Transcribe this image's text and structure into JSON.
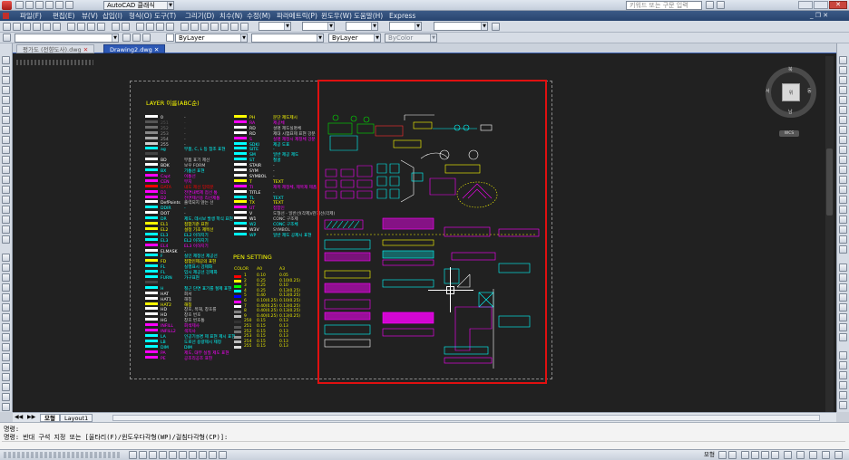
{
  "titlebar": {
    "workspace": "AutoCAD 클래식",
    "search_placeholder": "키워드 또는 구문 입력"
  },
  "menubar": {
    "items": [
      "파일(F)",
      "편집(E)",
      "뷰(V)",
      "삽입(I)",
      "형식(O)",
      "도구(T)",
      "그리기(D)",
      "치수(N)",
      "수정(M)",
      "파라메트릭(P)",
      "윈도우(W)",
      "도움말(H)",
      "Express"
    ]
  },
  "properties_bar": {
    "layer_combo": "ByLayer",
    "linetype_combo": "ByLayer",
    "color_combo": "ByColor"
  },
  "doc_tabs": [
    {
      "label": "평가도 (전향도사).dwg"
    },
    {
      "label": "Drawing2.dwg"
    }
  ],
  "viewcube": {
    "face": "위",
    "n": "북",
    "s": "남",
    "e": "동",
    "w": "서",
    "wcs": "WCS"
  },
  "drawing": {
    "layer_title": "LAYER 이름(ABC순)",
    "layers_left": [
      {
        "name": "0",
        "desc": "-",
        "color": "#ffffff"
      },
      {
        "name": "251",
        "desc": "-",
        "color": "#555555"
      },
      {
        "name": "252",
        "desc": "-",
        "color": "#6e6e6e"
      },
      {
        "name": "253",
        "desc": "-",
        "color": "#888888"
      },
      {
        "name": "254",
        "desc": "-",
        "color": "#a8a8a8"
      },
      {
        "name": "255",
        "desc": "-",
        "color": "#cccccc"
      },
      {
        "name": "ag",
        "desc": "부품, C, L 등 참조 표현",
        "color": "#00ffff"
      },
      {
        "name": "",
        "desc": "",
        "color": "#444444"
      },
      {
        "name": "BD",
        "desc": "부품 표기 제선",
        "color": "#ffffff"
      },
      {
        "name": "BDK",
        "desc": "보우 FORM",
        "color": "#ffffff"
      },
      {
        "name": "BX",
        "desc": "기통선 표현",
        "color": "#00ffff"
      },
      {
        "name": "Capt",
        "desc": "이통선",
        "color": "#ff00ff"
      },
      {
        "name": "CEN",
        "desc": "부지",
        "color": "#ff00ff"
      },
      {
        "name": "DATA",
        "desc": "내도 제선 입력분",
        "color": "#ff0000"
      },
      {
        "name": "D1",
        "desc": "전면내벽제 점선 통",
        "color": "#ff00ff"
      },
      {
        "name": "D2",
        "desc": "전면제선용 리선제통",
        "color": "#ff00ff"
      },
      {
        "name": "DefPoints",
        "desc": "출력되지 않는 선",
        "color": "#ffffff"
      },
      {
        "name": "DDIR",
        "desc": "-",
        "color": "#00ffff"
      },
      {
        "name": "DOT",
        "desc": "-",
        "color": "#ffffff"
      },
      {
        "name": "DR",
        "desc": "제도, 데시보 발생 학식 표현",
        "color": "#00ffff"
      },
      {
        "name": "EL1",
        "desc": "접합기준 표현",
        "color": "#ffff00"
      },
      {
        "name": "EL2",
        "desc": "설정 기초 제목선",
        "color": "#ffff00"
      },
      {
        "name": "EL3",
        "desc": "EL2 이하지기",
        "color": "#00ffff"
      },
      {
        "name": "EL3",
        "desc": "EL2 이하지기",
        "color": "#00ffff"
      },
      {
        "name": "EL4",
        "desc": "EL3 이하지기",
        "color": "#ff00ff"
      },
      {
        "name": "ELMASK",
        "desc": "-",
        "color": "#ffffff"
      },
      {
        "name": "F",
        "desc": "실인 제정선 제공선",
        "color": "#00ffff"
      },
      {
        "name": "FD",
        "desc": "접합인제공의 표현",
        "color": "#ffff00"
      },
      {
        "name": "FL",
        "desc": "실행표시 강제화",
        "color": "#00ffff"
      },
      {
        "name": "FL",
        "desc": "입시 제공선 강제화",
        "color": "#00ffff"
      },
      {
        "name": "FURN",
        "desc": "가구표현",
        "color": "#00ffff"
      },
      {
        "name": "",
        "desc": "",
        "color": "#444444"
      },
      {
        "name": "H",
        "desc": "철근 단면 표기를 절제 표현",
        "color": "#00ffff"
      },
      {
        "name": "HAT",
        "desc": "회서",
        "color": "#ffffff"
      },
      {
        "name": "HAT1",
        "desc": "해칭",
        "color": "#ffffff"
      },
      {
        "name": "HAT2",
        "desc": "해칭",
        "color": "#ffff00"
      },
      {
        "name": "HD",
        "desc": "창호, 목재, 창호를",
        "color": "#ffffff"
      },
      {
        "name": "HD",
        "desc": "창호 번호",
        "color": "#ffffff"
      },
      {
        "name": "HG",
        "desc": "창호 번호통",
        "color": "#ffffff"
      },
      {
        "name": "INFILL",
        "desc": "회색제사",
        "color": "#ff00ff"
      },
      {
        "name": "INFILL2",
        "desc": "색지사",
        "color": "#ff00ff"
      },
      {
        "name": "LA",
        "desc": "인공기설경 제 표현 제시 표현",
        "color": "#00ffff"
      },
      {
        "name": "LB",
        "desc": "도로선 용량제시 제정",
        "color": "#00ffff"
      },
      {
        "name": "DIM",
        "desc": "DIM",
        "color": "#00ffff"
      },
      {
        "name": "PA",
        "desc": "제도, 대부 실질 제도 표현",
        "color": "#ff00ff"
      },
      {
        "name": "PE",
        "desc": "공조리공조 표현",
        "color": "#ff00ff"
      }
    ],
    "layers_right": [
      {
        "name": "PH",
        "desc": "문단 제도제시",
        "color": "#ffff00"
      },
      {
        "name": "RA",
        "desc": "제공체",
        "color": "#ff00ff"
      },
      {
        "name": "RD",
        "desc": "설명 제도실명체",
        "color": "#ffffff"
      },
      {
        "name": "RD",
        "desc": "제대 시험표제 표현 강분",
        "color": "#ffffff"
      },
      {
        "name": "S",
        "desc": "실명 제정시 제정체 강분",
        "color": "#ff00ff"
      },
      {
        "name": "SDKI",
        "desc": "제공 도표",
        "color": "#00ffff"
      },
      {
        "name": "SITE",
        "desc": "-",
        "color": "#00ffff"
      },
      {
        "name": "SM",
        "desc": "일반 제공 제도",
        "color": "#00ffff"
      },
      {
        "name": "ST",
        "desc": "철골",
        "color": "#00ffff"
      },
      {
        "name": "STAIR",
        "desc": "-",
        "color": "#ffffff"
      },
      {
        "name": "SYM",
        "desc": "-",
        "color": "#ffffff"
      },
      {
        "name": "SYMBOL",
        "desc": "-",
        "color": "#ffffff"
      },
      {
        "name": "T",
        "desc": "TEXT",
        "color": "#ffff00"
      },
      {
        "name": "TI",
        "desc": "제목 제정체, 제목재 제품",
        "color": "#ff00ff"
      },
      {
        "name": "TITLE",
        "desc": "-",
        "color": "#ffffff"
      },
      {
        "name": "TL",
        "desc": "TEXT",
        "color": "#00ffff"
      },
      {
        "name": "TX",
        "desc": "TEXT",
        "color": "#ffff00"
      },
      {
        "name": "UT",
        "desc": "접합인",
        "color": "#ff00ff"
      },
      {
        "name": "V",
        "desc": "도형선 - 일반선(각제)/관계선(각제)",
        "color": "#ffffff"
      },
      {
        "name": "W1",
        "desc": "CONC 구조제",
        "color": "#ffffff"
      },
      {
        "name": "W2",
        "desc": "CONC 구조체",
        "color": "#00ffff"
      },
      {
        "name": "W3V",
        "desc": "SYMBOL",
        "color": "#ffffff"
      },
      {
        "name": "WP",
        "desc": "일반 제도 공제시 표현",
        "color": "#00ffff"
      }
    ],
    "pen_title": "PEN SETTING",
    "pen_headers": [
      "COLOR",
      "A0",
      "A3"
    ],
    "pen_rows": [
      {
        "color": "1",
        "a0": "0.10",
        "a3": "0.05",
        "sw": "#ff0000"
      },
      {
        "color": "2",
        "a0": "0.25",
        "a3": "0.10(0.25)",
        "sw": "#ffff00"
      },
      {
        "color": "3",
        "a0": "0.25",
        "a3": "0.10",
        "sw": "#00ff00"
      },
      {
        "color": "4",
        "a0": "0.25",
        "a3": "0.13(0.25)",
        "sw": "#00ffff"
      },
      {
        "color": "5",
        "a0": "0.40",
        "a3": "0.13(0.25)",
        "sw": "#0000ff"
      },
      {
        "color": "6",
        "a0": "0.10(0.25)",
        "a3": "0.10(0.25)",
        "sw": "#ff00ff"
      },
      {
        "color": "7",
        "a0": "0.40(0.25)",
        "a3": "0.13(0.25)",
        "sw": "#ffffff"
      },
      {
        "color": "8",
        "a0": "0.40(0.25)",
        "a3": "0.13(0.25)",
        "sw": "#808080"
      },
      {
        "color": "9",
        "a0": "0.40(0.25)",
        "a3": "0.13(0.25)",
        "sw": "#c0c0c0"
      },
      {
        "color": "250",
        "a0": "0.15",
        "a3": "0.13",
        "sw": "#333333"
      },
      {
        "color": "251",
        "a0": "0.15",
        "a3": "0.13",
        "sw": "#555555"
      },
      {
        "color": "252",
        "a0": "0.15",
        "a3": "0.13",
        "sw": "#777777"
      },
      {
        "color": "253",
        "a0": "0.15",
        "a3": "0.13",
        "sw": "#999999"
      },
      {
        "color": "254",
        "a0": "0.15",
        "a3": "0.13",
        "sw": "#bbbbbb"
      },
      {
        "color": "255",
        "a0": "0.15",
        "a3": "0.13",
        "sw": "#dddddd"
      }
    ]
  },
  "layout_tabs": {
    "model": "모형",
    "layout1": "Layout1"
  },
  "command": {
    "history": "명령:",
    "line": "명령: 반대 구석 지정 또는 [울타리(F)/윈도우다각형(WP)/걸침다각형(CP)]:"
  },
  "status": {
    "model_label": "모형"
  },
  "colors": {
    "highlight_box": "#e01010",
    "canvas": "#212121",
    "menubar": "#2f4f7c"
  }
}
